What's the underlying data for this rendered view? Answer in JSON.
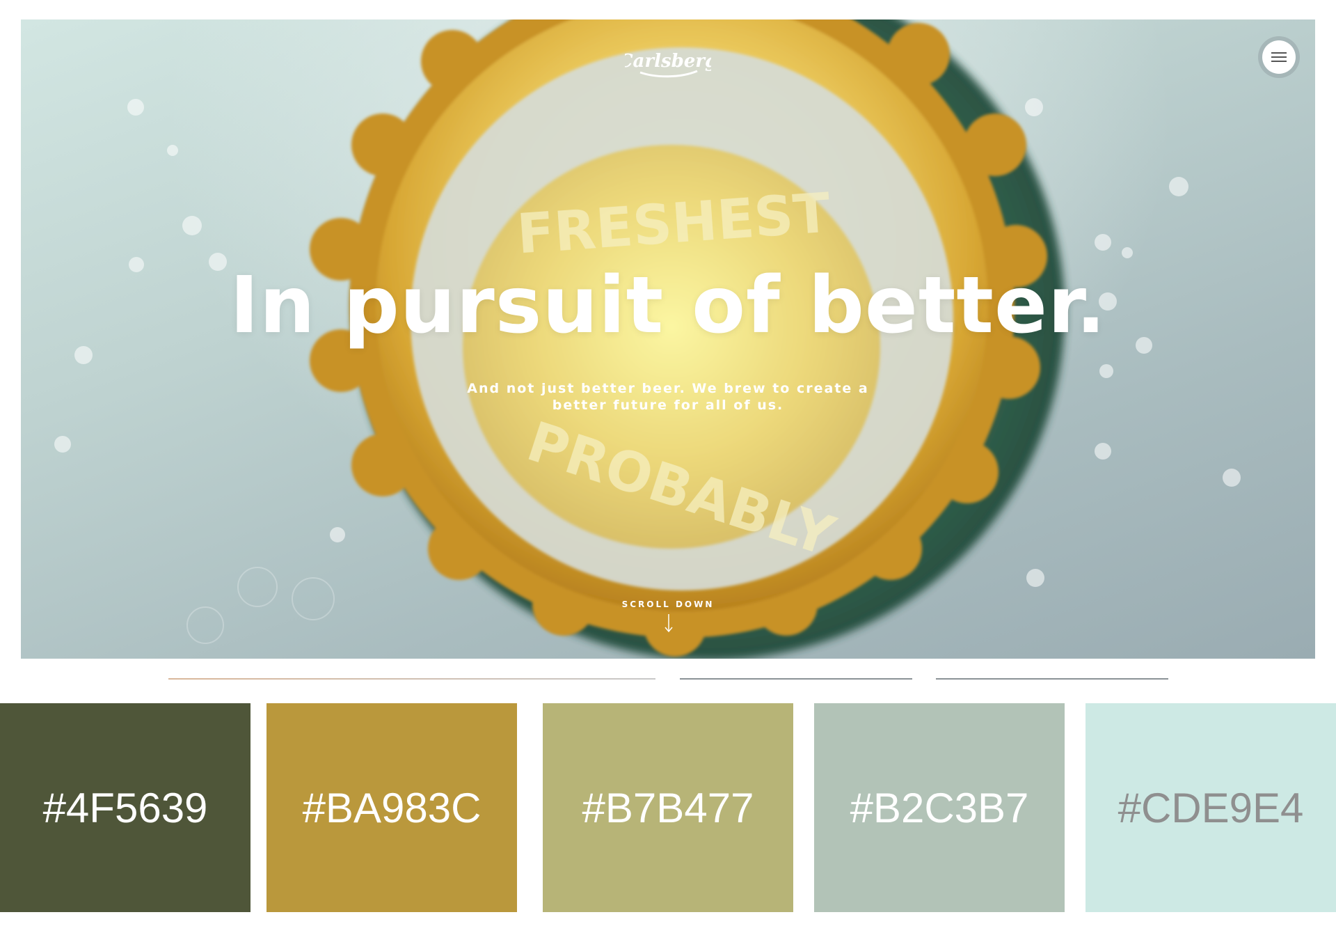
{
  "hero": {
    "logo_text": "Carlsberg",
    "headline": "In pursuit of better.",
    "subtext": "And not just better beer. We brew to create a better future for all of us.",
    "scroll_label": "SCROLL DOWN",
    "cap_text_top": "FRESHEST",
    "cap_text_bottom": "PROBABLY"
  },
  "menu": {
    "icon": "hamburger-menu-icon"
  },
  "palette": {
    "swatches": [
      {
        "hex": "#4F5639",
        "label": "#4F5639",
        "text_color": "#ffffff"
      },
      {
        "hex": "#BA983C",
        "label": "#BA983C",
        "text_color": "#ffffff"
      },
      {
        "hex": "#B7B477",
        "label": "#B7B477",
        "text_color": "#ffffff"
      },
      {
        "hex": "#B2C3B7",
        "label": "#B2C3B7",
        "text_color": "#ffffff"
      },
      {
        "hex": "#CDE9E4",
        "label": "#CDE9E4",
        "text_color": "#8f8f8f"
      }
    ]
  }
}
